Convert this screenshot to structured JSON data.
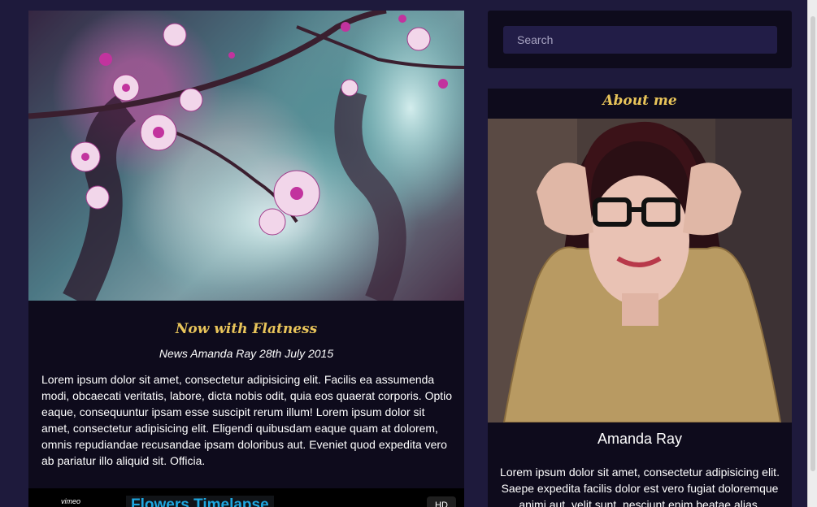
{
  "post": {
    "title": "Now with Flatness",
    "meta": "News Amanda Ray 28th July 2015",
    "body": "Lorem ipsum dolor sit amet, consectetur adipisicing elit. Facilis ea assumenda modi, obcaecati veritatis, labore, dicta nobis odit, quia eos quaerat corporis. Optio eaque, consequuntur ipsam esse suscipit rerum illum! Lorem ipsum dolor sit amet, consectetur adipisicing elit. Eligendi quibusdam eaque quam at dolorem, omnis repudiandae recusandae ipsam doloribus aut. Eveniet quod expedita vero ab pariatur illo aliquid sit. Officia.",
    "image_icon": "cherry-blossom-photo"
  },
  "video": {
    "logo": "vimeo",
    "title": "Flowers Timelapse",
    "badge": "HD"
  },
  "search": {
    "placeholder": "Search"
  },
  "about": {
    "title": "About me",
    "name": "Amanda Ray",
    "body": "Lorem ipsum dolor sit amet, consectetur adipisicing elit. Saepe expedita facilis dolor est vero fugiat doloremque animi aut, velit sunt, nesciunt enim beatae alias.",
    "photo_icon": "portrait-photo"
  },
  "colors": {
    "background": "#1e1a3c",
    "panel": "#0e0b1c",
    "accent": "#e8c45a",
    "search_bg": "#221d47",
    "video_title": "#1ea7e0"
  }
}
